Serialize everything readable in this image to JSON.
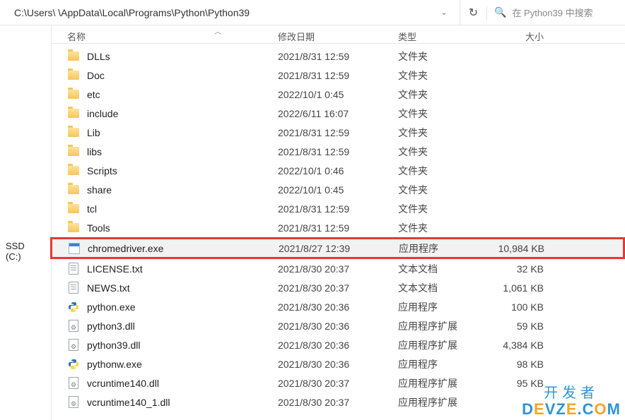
{
  "address_bar": {
    "path": "C:\\Users\\        \\AppData\\Local\\Programs\\Python\\Python39"
  },
  "search": {
    "placeholder": "在 Python39 中搜索"
  },
  "columns": {
    "name": "名称",
    "date": "修改日期",
    "type": "类型",
    "size": "大小"
  },
  "sidebar": {
    "ssd_label": "SSD (C:)"
  },
  "rows": [
    {
      "icon": "folder",
      "name": "DLLs",
      "date": "2021/8/31 12:59",
      "type": "文件夹",
      "size": ""
    },
    {
      "icon": "folder",
      "name": "Doc",
      "date": "2021/8/31 12:59",
      "type": "文件夹",
      "size": ""
    },
    {
      "icon": "folder",
      "name": "etc",
      "date": "2022/10/1 0:45",
      "type": "文件夹",
      "size": ""
    },
    {
      "icon": "folder",
      "name": "include",
      "date": "2022/6/11 16:07",
      "type": "文件夹",
      "size": ""
    },
    {
      "icon": "folder",
      "name": "Lib",
      "date": "2021/8/31 12:59",
      "type": "文件夹",
      "size": ""
    },
    {
      "icon": "folder",
      "name": "libs",
      "date": "2021/8/31 12:59",
      "type": "文件夹",
      "size": ""
    },
    {
      "icon": "folder",
      "name": "Scripts",
      "date": "2022/10/1 0:46",
      "type": "文件夹",
      "size": ""
    },
    {
      "icon": "folder",
      "name": "share",
      "date": "2022/10/1 0:45",
      "type": "文件夹",
      "size": ""
    },
    {
      "icon": "folder",
      "name": "tcl",
      "date": "2021/8/31 12:59",
      "type": "文件夹",
      "size": ""
    },
    {
      "icon": "folder",
      "name": "Tools",
      "date": "2021/8/31 12:59",
      "type": "文件夹",
      "size": ""
    },
    {
      "icon": "exe",
      "name": "chromedriver.exe",
      "date": "2021/8/27 12:39",
      "type": "应用程序",
      "size": "10,984 KB",
      "highlight": true
    },
    {
      "icon": "txt",
      "name": "LICENSE.txt",
      "date": "2021/8/30 20:37",
      "type": "文本文档",
      "size": "32 KB"
    },
    {
      "icon": "txt",
      "name": "NEWS.txt",
      "date": "2021/8/30 20:37",
      "type": "文本文档",
      "size": "1,061 KB"
    },
    {
      "icon": "py",
      "name": "python.exe",
      "date": "2021/8/30 20:36",
      "type": "应用程序",
      "size": "100 KB"
    },
    {
      "icon": "dll",
      "name": "python3.dll",
      "date": "2021/8/30 20:36",
      "type": "应用程序扩展",
      "size": "59 KB"
    },
    {
      "icon": "dll",
      "name": "python39.dll",
      "date": "2021/8/30 20:36",
      "type": "应用程序扩展",
      "size": "4,384 KB"
    },
    {
      "icon": "py",
      "name": "pythonw.exe",
      "date": "2021/8/30 20:36",
      "type": "应用程序",
      "size": "98 KB"
    },
    {
      "icon": "dll",
      "name": "vcruntime140.dll",
      "date": "2021/8/30 20:37",
      "type": "应用程序扩展",
      "size": "95 KB"
    },
    {
      "icon": "dll",
      "name": "vcruntime140_1.dll",
      "date": "2021/8/30 20:37",
      "type": "应用程序扩展",
      "size": ""
    }
  ],
  "watermark": {
    "line1": "开发者",
    "line2a": "D",
    "line2b": "E",
    "line2c": "V",
    "line2d": "Z",
    "line2e": "E",
    "line2f": ".",
    "line2g": "C",
    "line2h": "O",
    "line2i": "M"
  }
}
